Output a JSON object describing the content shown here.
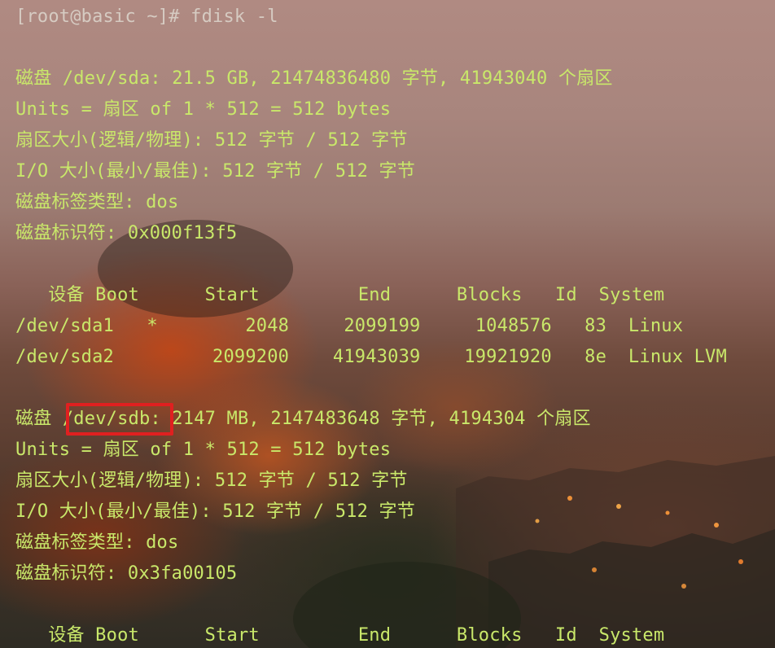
{
  "terminal": {
    "prompt": "[root@basic ~]# fdisk -l",
    "disk1": {
      "header": "磁盘 /dev/sda: 21.5 GB, 21474836480 字节, 41943040 个扇区",
      "units": "Units = 扇区 of 1 * 512 = 512 bytes",
      "sector_size": "扇区大小(逻辑/物理): 512 字节 / 512 字节",
      "io_size": "I/O 大小(最小/最佳): 512 字节 / 512 字节",
      "label_type": "磁盘标签类型: dos",
      "identifier": "磁盘标识符: 0x000f13f5",
      "table_header": "   设备 Boot      Start         End      Blocks   Id  System",
      "rows": [
        "/dev/sda1   *        2048     2099199     1048576   83  Linux",
        "/dev/sda2         2099200    41943039    19921920   8e  Linux LVM"
      ]
    },
    "disk2": {
      "header_prefix": "磁盘 ",
      "device": "/dev/sdb",
      "header_suffix": ": 2147 MB, 2147483648 字节, 4194304 个扇区",
      "units": "Units = 扇区 of 1 * 512 = 512 bytes",
      "sector_size": "扇区大小(逻辑/物理): 512 字节 / 512 字节",
      "io_size": "I/O 大小(最小/最佳): 512 字节 / 512 字节",
      "label_type": "磁盘标签类型: dos",
      "identifier": "磁盘标识符: 0x3fa00105",
      "table_header": "   设备 Boot      Start         End      Blocks   Id  System"
    }
  },
  "colors": {
    "output_text": "#c9e86a",
    "prompt_text": "#d6cbc2",
    "highlight_border": "#e02020"
  }
}
